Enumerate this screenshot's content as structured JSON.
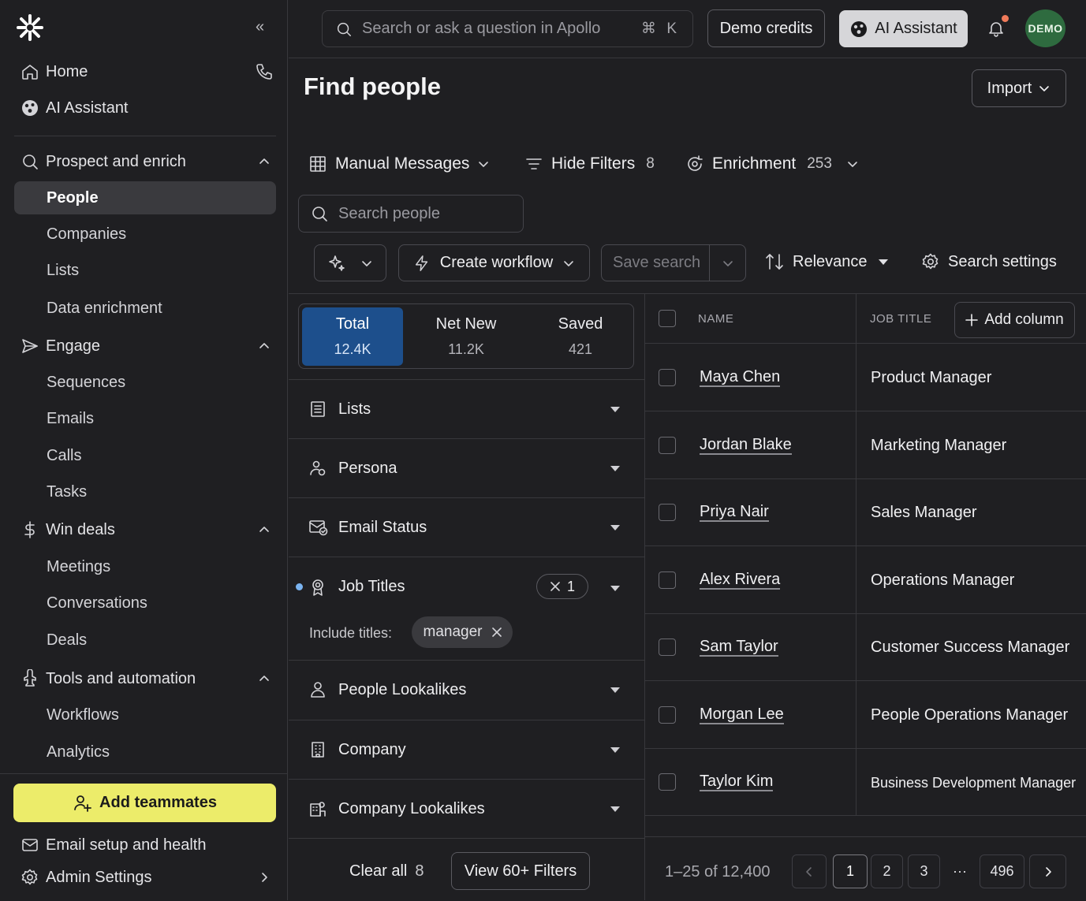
{
  "sidebar": {
    "home": "Home",
    "ai_assistant": "AI Assistant",
    "sections": [
      {
        "label": "Prospect and enrich",
        "items": [
          "People",
          "Companies",
          "Lists",
          "Data enrichment"
        ]
      },
      {
        "label": "Engage",
        "items": [
          "Sequences",
          "Emails",
          "Calls",
          "Tasks"
        ]
      },
      {
        "label": "Win deals",
        "items": [
          "Meetings",
          "Conversations",
          "Deals"
        ]
      },
      {
        "label": "Tools and automation",
        "items": [
          "Workflows",
          "Analytics"
        ]
      }
    ],
    "add_teammates": "Add teammates",
    "email_setup": "Email setup and health",
    "admin_settings": "Admin Settings"
  },
  "topbar": {
    "search_placeholder": "Search or ask a question in Apollo",
    "shortcut": "⌘ K",
    "demo_credits": "Demo credits",
    "ai_assistant": "AI Assistant",
    "avatar": "DEMO"
  },
  "page": {
    "title": "Find people",
    "import": "Import"
  },
  "toolbar": {
    "manual_messages": "Manual Messages",
    "hide_filters": "Hide Filters",
    "hide_filters_count": "8",
    "enrichment": "Enrichment",
    "enrichment_count": "253",
    "search_people_placeholder": "Search people",
    "create_workflow": "Create workflow",
    "save_search": "Save search",
    "relevance": "Relevance",
    "search_settings": "Search settings"
  },
  "tabs": [
    {
      "label": "Total",
      "value": "12.4K"
    },
    {
      "label": "Net New",
      "value": "11.2K"
    },
    {
      "label": "Saved",
      "value": "421"
    }
  ],
  "filters": {
    "lists": "Lists",
    "persona": "Persona",
    "email_status": "Email Status",
    "job_titles": "Job Titles",
    "job_titles_count": "1",
    "include_titles_label": "Include titles:",
    "include_titles_value": "manager",
    "people_lookalikes": "People Lookalikes",
    "company": "Company",
    "company_lookalikes": "Company Lookalikes",
    "clear_all": "Clear all",
    "clear_all_count": "8",
    "view_more": "View 60+ Filters"
  },
  "table": {
    "col_name": "NAME",
    "col_job": "JOB TITLE",
    "add_column": "Add column",
    "rows": [
      {
        "name": "Maya Chen",
        "title": "Product Manager"
      },
      {
        "name": "Jordan Blake",
        "title": "Marketing Manager"
      },
      {
        "name": "Priya Nair",
        "title": "Sales Manager"
      },
      {
        "name": "Alex Rivera",
        "title": "Operations Manager"
      },
      {
        "name": "Sam Taylor",
        "title": "Customer Success Manager"
      },
      {
        "name": "Morgan Lee",
        "title": "People Operations Manager"
      },
      {
        "name": "Taylor Kim",
        "title": "Business Development Manager"
      }
    ]
  },
  "pagination": {
    "range": "1–25 of 12,400",
    "pages": [
      "1",
      "2",
      "3"
    ],
    "ellipsis": "···",
    "last": "496"
  },
  "colors": {
    "accent_yellow": "#ecec6a",
    "tab_active": "#1d4f8c",
    "avatar_bg": "#2e6b3f"
  }
}
